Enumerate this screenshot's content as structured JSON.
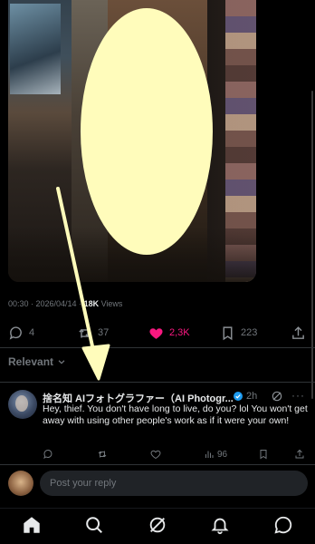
{
  "post": {
    "timestamp": "00:30 · 2026/04/14 · ",
    "views_count": "18K",
    "views_label": " Views"
  },
  "actions": {
    "replies": "4",
    "reposts": "37",
    "likes": "2,3K",
    "bookmarks": "223"
  },
  "sort_filter": {
    "label": "Relevant"
  },
  "reply": {
    "author": "捨名知 AIフォトグラファー（AI Photogr...",
    "time": "2h",
    "more": "···",
    "text": "Hey, thief. You don't have long to live, do you? lol You won't get away with using other people's work as if it were your own!",
    "views": "96"
  },
  "composer": {
    "placeholder": "Post your reply"
  },
  "colors": {
    "like": "#f91880",
    "verified": "#1d9bf0",
    "highlight_blob": "#fffcbb",
    "background": "#000000"
  },
  "icons": {
    "reply": "reply-icon",
    "repost": "repost-icon",
    "like": "heart-filled-icon",
    "bookmark": "bookmark-icon",
    "share": "share-icon",
    "nav": [
      "home-icon",
      "search-icon",
      "grok-icon",
      "bell-icon",
      "messages-icon"
    ]
  }
}
